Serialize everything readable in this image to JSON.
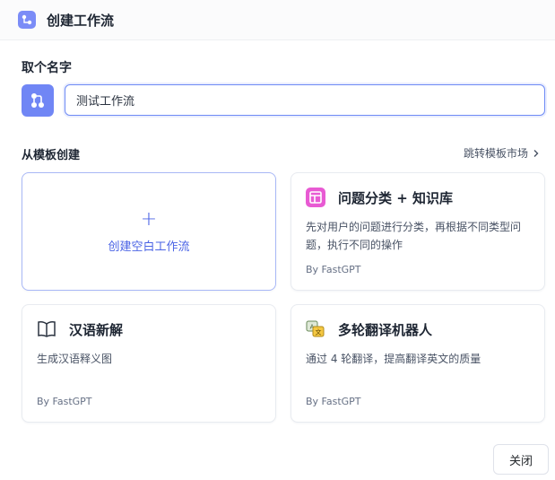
{
  "header": {
    "title": "创建工作流",
    "icon": "workflow-icon"
  },
  "name_section": {
    "label": "取个名字",
    "input_value": "测试工作流",
    "avatar_icon": "workflow-icon"
  },
  "template_section": {
    "label": "从模板创建",
    "jump_link": "跳转模板市场",
    "blank_card_label": "创建空白工作流",
    "cards": [
      {
        "title": "问题分类 + 知识库",
        "description": "先对用户的问题进行分类，再根据不同类型问题，执行不同的操作",
        "author": "By FastGPT",
        "icon": "classify-icon"
      },
      {
        "title": "汉语新解",
        "description": "生成汉语释义图",
        "author": "By FastGPT",
        "icon": "book-icon"
      },
      {
        "title": "多轮翻译机器人",
        "description": "通过 4 轮翻译，提高翻译英文的质量",
        "author": "By FastGPT",
        "icon": "translate-icon"
      }
    ]
  },
  "footer": {
    "close_label": "关闭"
  },
  "colors": {
    "accent": "#4b64e5",
    "icon_purple": "#7086f5",
    "pink": "#e85ad3"
  }
}
